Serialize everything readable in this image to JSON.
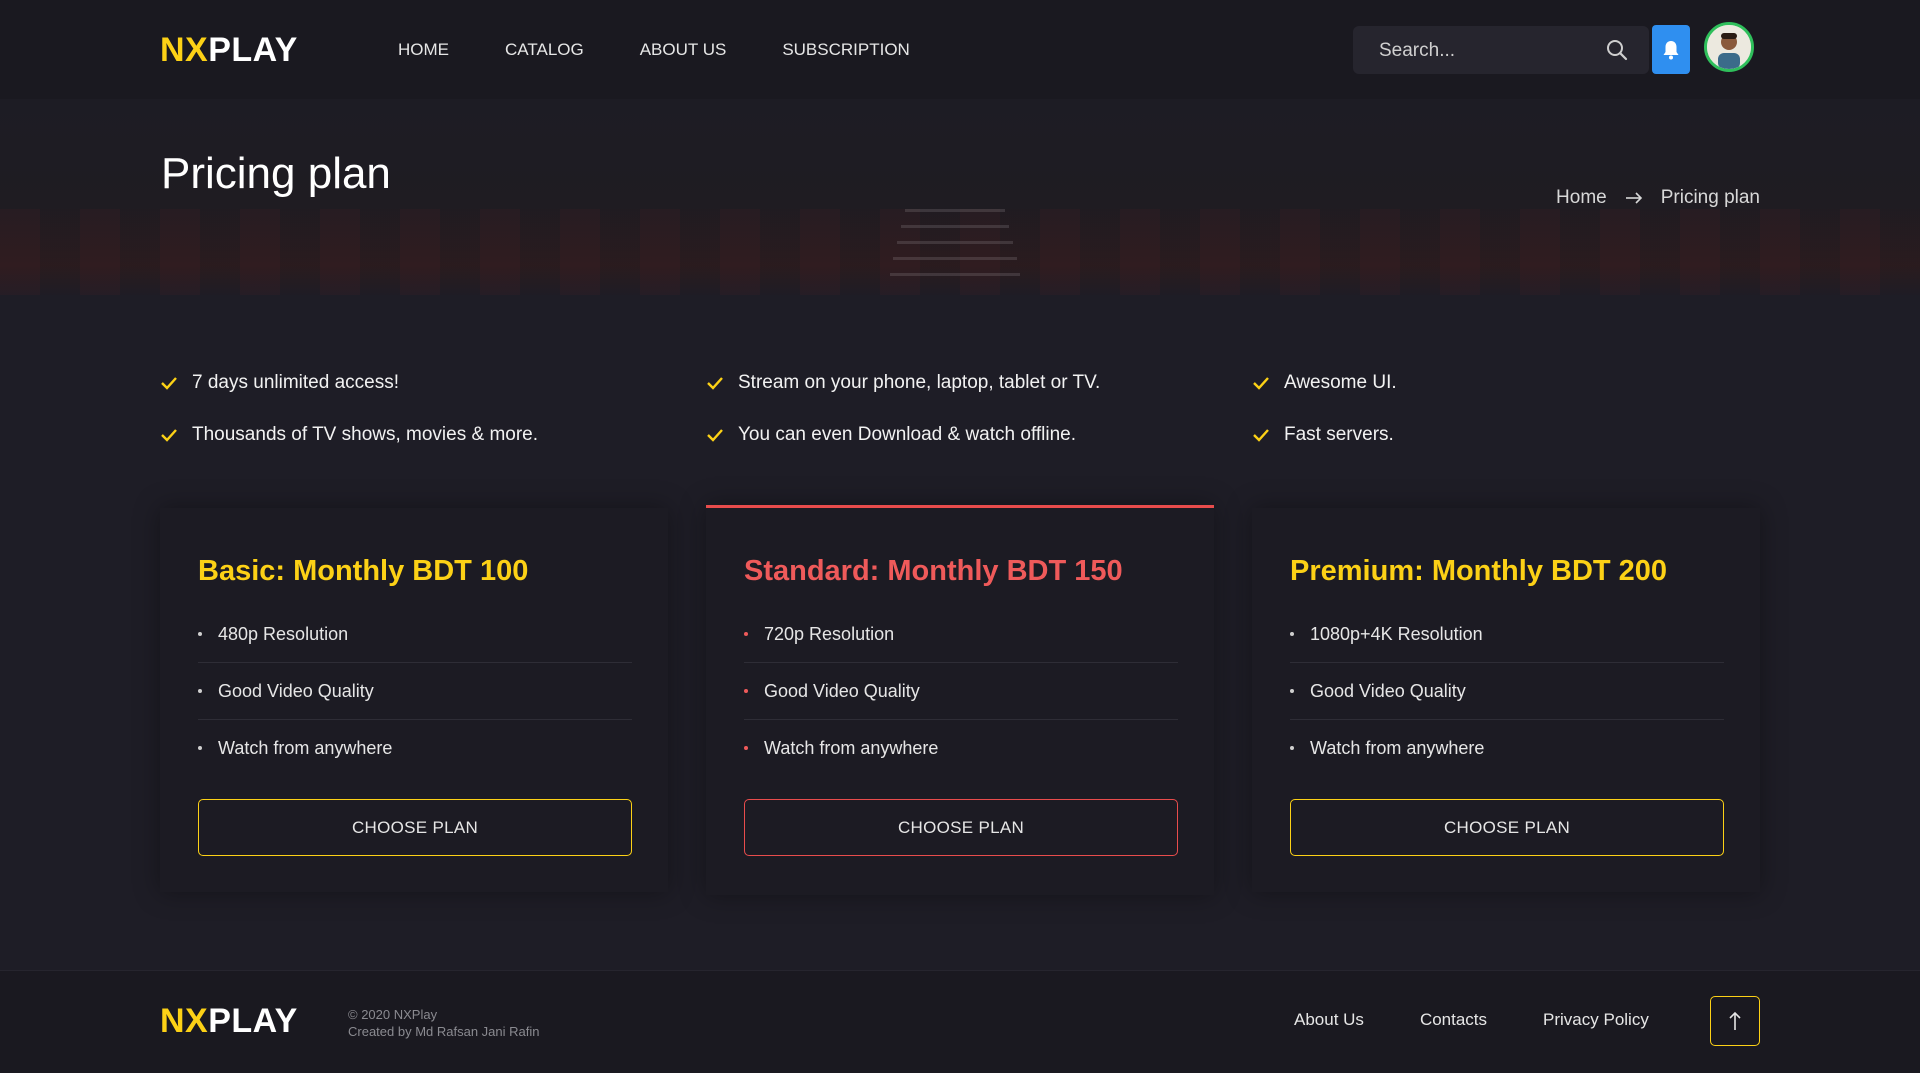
{
  "header": {
    "logo_nx": "NX",
    "logo_play": "PLAY",
    "nav": [
      "HOME",
      "CATALOG",
      "ABOUT US",
      "SUBSCRIPTION"
    ],
    "search_placeholder": "Search...",
    "search_icon": "search-icon",
    "notification_icon": "bell-icon",
    "notification_color": "#2f8ff0"
  },
  "hero": {
    "title": "Pricing plan",
    "breadcrumb": {
      "home": "Home",
      "current": "Pricing plan"
    }
  },
  "features": [
    "7 days unlimited access!",
    "Thousands of TV shows, movies & more.",
    "Stream on your phone, laptop, tablet or TV.",
    "You can even Download & watch offline.",
    "Awesome UI.",
    "Fast servers."
  ],
  "plans": [
    {
      "title": "Basic: Monthly BDT 100",
      "features": [
        "480p Resolution",
        "Good Video Quality",
        "Watch from anywhere"
      ],
      "button": "CHOOSE PLAN"
    },
    {
      "title": "Standard: Monthly BDT 150",
      "features": [
        "720p Resolution",
        "Good Video Quality",
        "Watch from anywhere"
      ],
      "button": "CHOOSE PLAN"
    },
    {
      "title": "Premium: Monthly BDT 200",
      "features": [
        "1080p+4K Resolution",
        "Good Video Quality",
        "Watch from anywhere"
      ],
      "button": "CHOOSE PLAN"
    }
  ],
  "footer": {
    "logo_nx": "NX",
    "logo_play": "PLAY",
    "copyright": "© 2020 NXPlay",
    "credit": "Created by Md Rafsan Jani Rafin",
    "links": [
      "About Us",
      "Contacts",
      "Privacy Policy"
    ],
    "to_top_icon": "arrow-up-icon"
  },
  "colors": {
    "accent_yellow": "#fcd116",
    "accent_red": "#e84c4c",
    "background": "#1e1d26"
  }
}
